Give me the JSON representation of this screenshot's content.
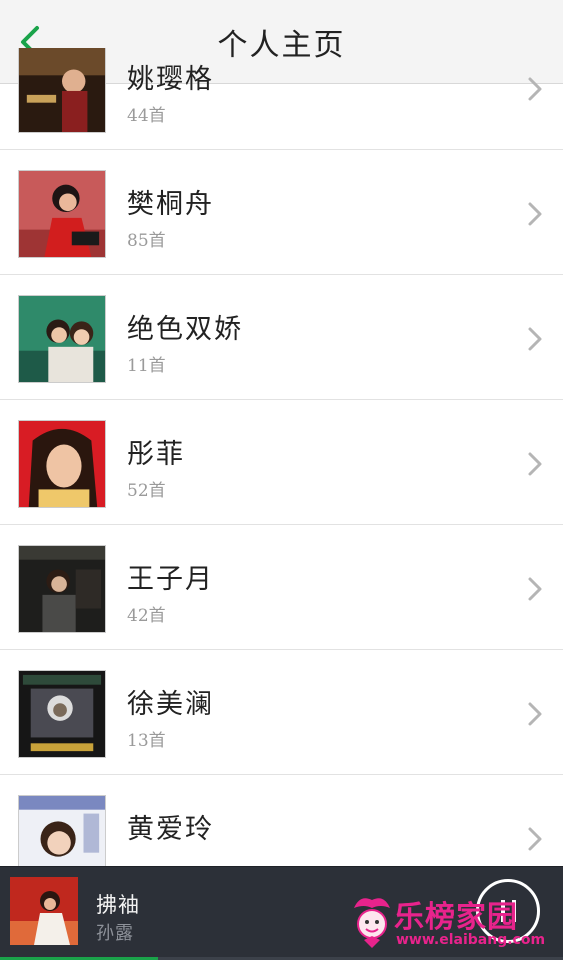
{
  "header": {
    "title": "个人主页",
    "back_icon": "chevron-left-icon",
    "accent_color": "#1aa34a"
  },
  "artists": [
    {
      "name": "姚璎格",
      "count": "44首"
    },
    {
      "name": "樊桐舟",
      "count": "85首"
    },
    {
      "name": "绝色双娇",
      "count": "11首"
    },
    {
      "name": "彤菲",
      "count": "52首"
    },
    {
      "name": "王子月",
      "count": "42首"
    },
    {
      "name": "徐美澜",
      "count": "13首"
    },
    {
      "name": "黄爱玲",
      "count": ""
    }
  ],
  "player": {
    "title": "拂袖",
    "artist": "孙露",
    "state_icon": "pause-icon",
    "progress": 0.28
  },
  "watermark": {
    "text": "乐榜家园",
    "url": "www.elaibang.com"
  }
}
